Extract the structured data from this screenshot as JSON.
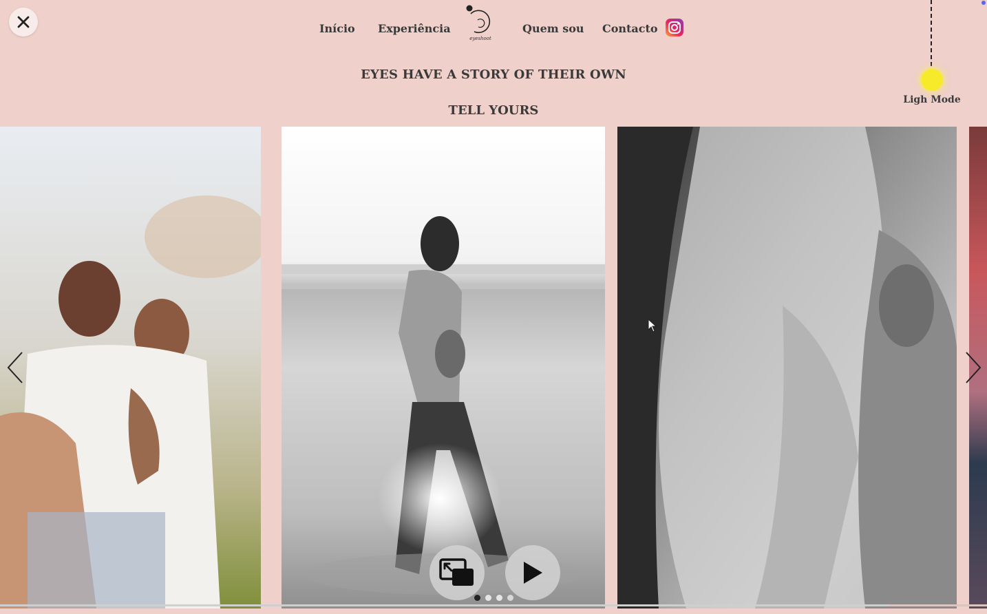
{
  "nav": {
    "items": [
      {
        "label": "Início"
      },
      {
        "label": "Experiência"
      },
      {
        "label": "Quem sou"
      },
      {
        "label": "Contacto"
      }
    ],
    "logo_text": "eyeshoot"
  },
  "hero": {
    "title": "EYES HAVE A STORY OF THEIR OWN",
    "subtitle": "TELL YOURS"
  },
  "mode_toggle": {
    "label": "Ligh Mode",
    "sun_color": "#f6ea2a"
  },
  "slideshow": {
    "slides": [
      {
        "alt": "couple-embracing-outdoors"
      },
      {
        "alt": "pregnant-woman-walking-on-beach"
      },
      {
        "alt": "couple-silhouette-close"
      },
      {
        "alt": "sunset-partial"
      }
    ],
    "dot_count": 4,
    "active_dot": 0,
    "progress": 0.9
  },
  "colors": {
    "background": "#efd0ca",
    "text": "#3a3a3a",
    "accent_dot": "#5a66ee"
  }
}
